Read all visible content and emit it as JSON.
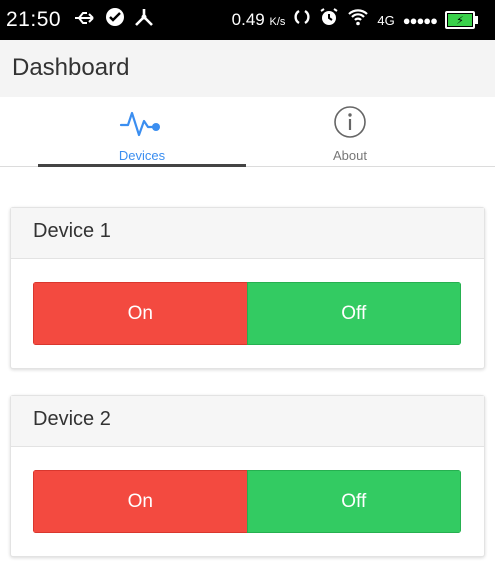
{
  "status_bar": {
    "time": "21:50",
    "speed": "0.49",
    "speed_unit": "K/s",
    "network": "4G",
    "signal_dots": "●●●●●"
  },
  "appbar": {
    "title": "Dashboard"
  },
  "tabs": [
    {
      "label": "Devices",
      "icon": "pulse-icon",
      "active": true
    },
    {
      "label": "About",
      "icon": "info-icon",
      "active": false
    }
  ],
  "devices": [
    {
      "title": "Device 1",
      "on_label": "On",
      "off_label": "Off"
    },
    {
      "title": "Device 2",
      "on_label": "On",
      "off_label": "Off"
    }
  ],
  "colors": {
    "on_red": "#f34a40",
    "off_green": "#33cb62",
    "active_tab_blue": "#3b8ef0"
  }
}
